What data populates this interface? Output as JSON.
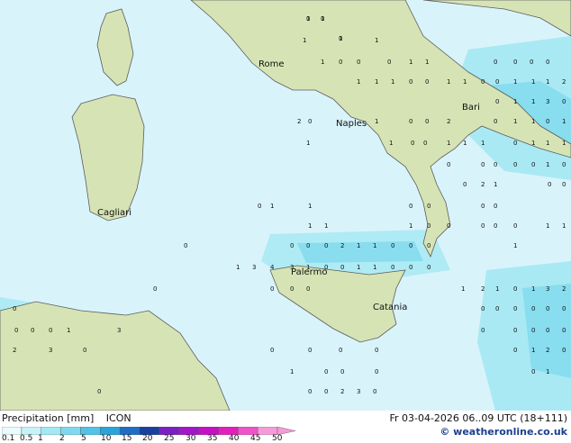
{
  "legend": {
    "title": "Precipitation [mm]",
    "model": "ICON",
    "ticks": [
      "0.1",
      "0.5",
      "1",
      "2",
      "5",
      "10",
      "15",
      "20",
      "25",
      "30",
      "35",
      "40",
      "45",
      "50"
    ],
    "colors": [
      "#e9fbfd",
      "#c6f2f8",
      "#a3e8f3",
      "#7fd9ee",
      "#52c3e6",
      "#2aa4da",
      "#1e6ec5",
      "#1a3f9e",
      "#7a20c0",
      "#a216c9",
      "#c70fc6",
      "#e21fbd",
      "#ee53c8",
      "#f59bd8"
    ]
  },
  "run_info": "Fr 03-04-2026 06..09 UTC (18+111)",
  "credit": "© weatheronline.co.uk",
  "cities": [
    {
      "name": "Rome"
    },
    {
      "name": "Bari"
    },
    {
      "name": "Naples"
    },
    {
      "name": "Cagliari"
    },
    {
      "name": "Palermo"
    },
    {
      "name": "Catania"
    }
  ],
  "values": [
    "1",
    "1",
    "1",
    "1",
    "1",
    "1",
    "0",
    "0",
    "0",
    "1",
    "1",
    "0",
    "0",
    "0",
    "0",
    "1",
    "1",
    "1",
    "0",
    "0",
    "1",
    "1",
    "0",
    "0",
    "1",
    "1",
    "1",
    "2",
    "2",
    "0",
    "0",
    "1",
    "1",
    "3",
    "0",
    "0",
    "1",
    "1",
    "0",
    "1",
    "0",
    "0",
    "2",
    "1",
    "1",
    "1",
    "0",
    "0",
    "1",
    "1",
    "1",
    "0",
    "1",
    "1",
    "1",
    "0",
    "0",
    "0",
    "0",
    "0",
    "1",
    "0",
    "0",
    "2",
    "1",
    "0",
    "0",
    "0",
    "1",
    "1",
    "0",
    "0",
    "0",
    "0",
    "1",
    "1",
    "1",
    "0",
    "0",
    "0",
    "0",
    "0",
    "1",
    "1",
    "0",
    "0",
    "0",
    "0",
    "2",
    "1",
    "1",
    "0",
    "0",
    "0",
    "1",
    "1",
    "3",
    "4",
    "3",
    "1",
    "0",
    "0",
    "1",
    "1",
    "0",
    "0",
    "0",
    "0",
    "0",
    "0",
    "0",
    "1",
    "2",
    "1",
    "0",
    "1",
    "3",
    "2",
    "0",
    "0",
    "0",
    "0",
    "1",
    "3",
    "0",
    "0",
    "0",
    "0",
    "0",
    "0",
    "2",
    "3",
    "0",
    "0",
    "0",
    "0",
    "0",
    "0",
    "0",
    "0",
    "0",
    "0",
    "0",
    "1",
    "2",
    "0",
    "1",
    "0",
    "0",
    "0",
    "0",
    "1",
    "0",
    "0",
    "0",
    "2",
    "3",
    "0",
    "0",
    "0",
    "0"
  ]
}
